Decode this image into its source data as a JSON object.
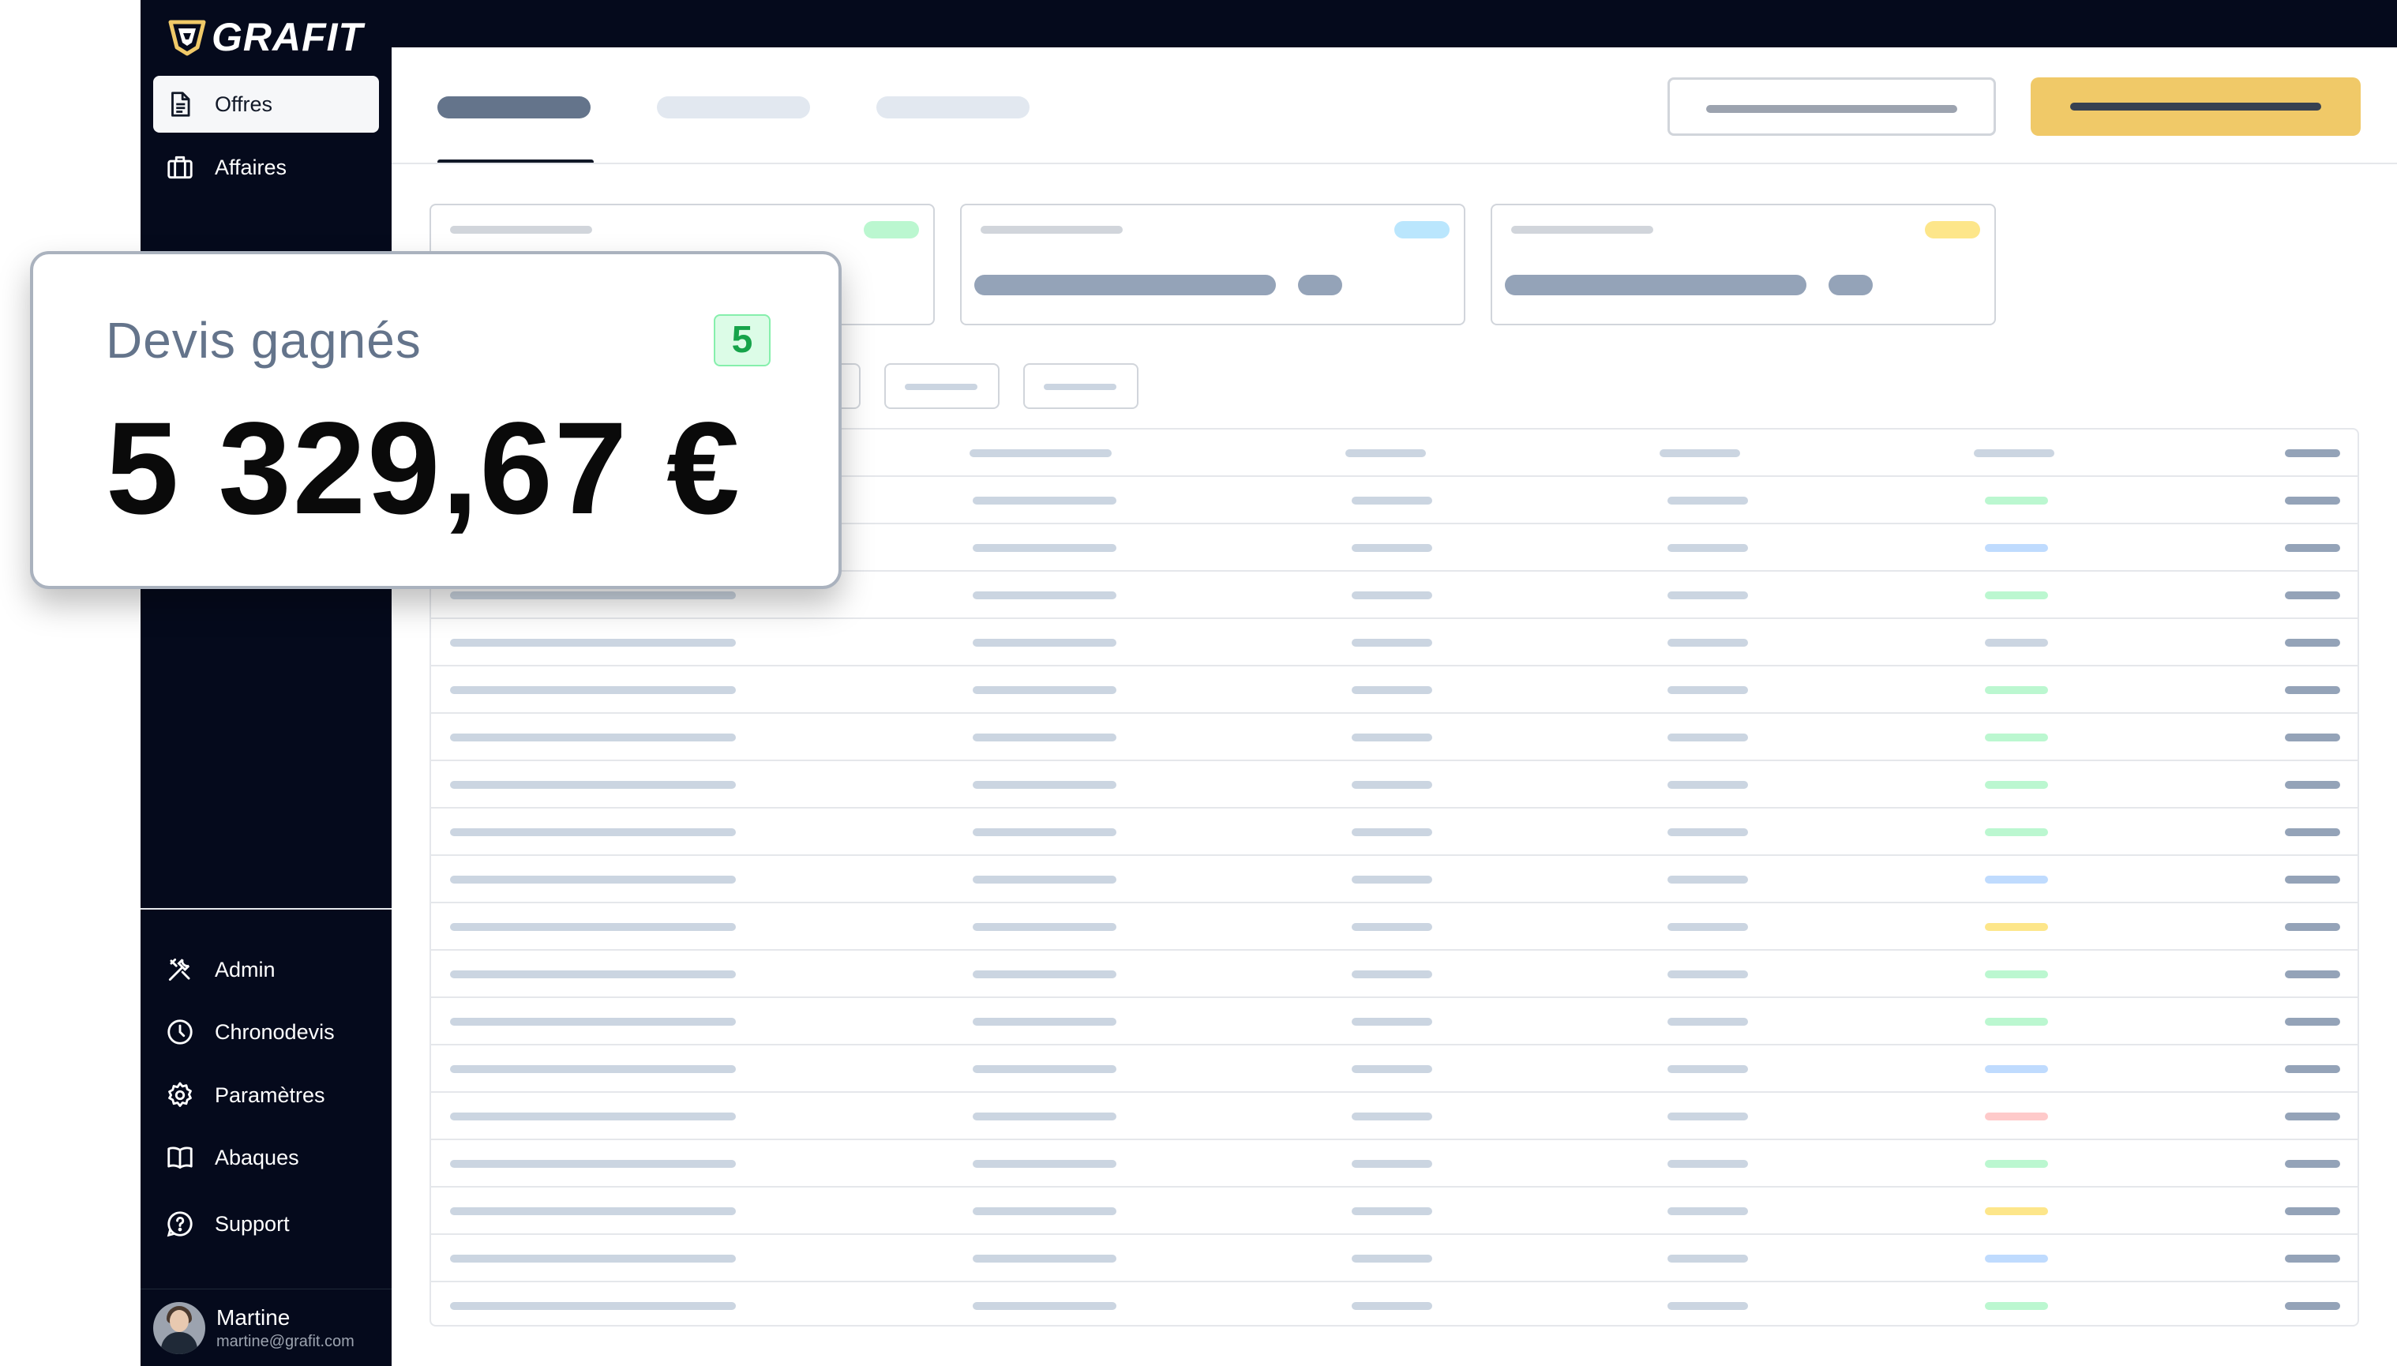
{
  "app": {
    "brand": "GRAFIT",
    "brand_color": "#f0c968"
  },
  "sidebar": {
    "items": [
      {
        "label": "Offres",
        "icon": "document-icon",
        "active": true
      },
      {
        "label": "Affaires",
        "icon": "briefcase-icon",
        "active": false
      }
    ],
    "bottom_items": [
      {
        "label": "Admin",
        "icon": "tools-icon"
      },
      {
        "label": "Chronodevis",
        "icon": "clock-icon"
      },
      {
        "label": "Paramètres",
        "icon": "gear-icon"
      },
      {
        "label": "Abaques",
        "icon": "book-icon"
      },
      {
        "label": "Support",
        "icon": "help-icon"
      }
    ],
    "user": {
      "name": "Martine",
      "email": "martine@grafit.com"
    }
  },
  "stat_card": {
    "label": "Devis gagnés",
    "count": "5",
    "amount": "5 329,67 €"
  },
  "colors": {
    "accent_yellow": "#f0c968",
    "status_green": "#bbf7d0",
    "status_blue": "#bfdbfe",
    "status_yellow": "#fde68a",
    "status_red": "#fecaca",
    "sidebar_bg": "#050a1c"
  },
  "table": {
    "row_statuses": [
      "green",
      "blue",
      "green",
      "gray",
      "green",
      "green",
      "green",
      "green",
      "blue",
      "yellow",
      "green",
      "green",
      "blue",
      "red",
      "green",
      "yellow",
      "blue",
      "green"
    ]
  }
}
